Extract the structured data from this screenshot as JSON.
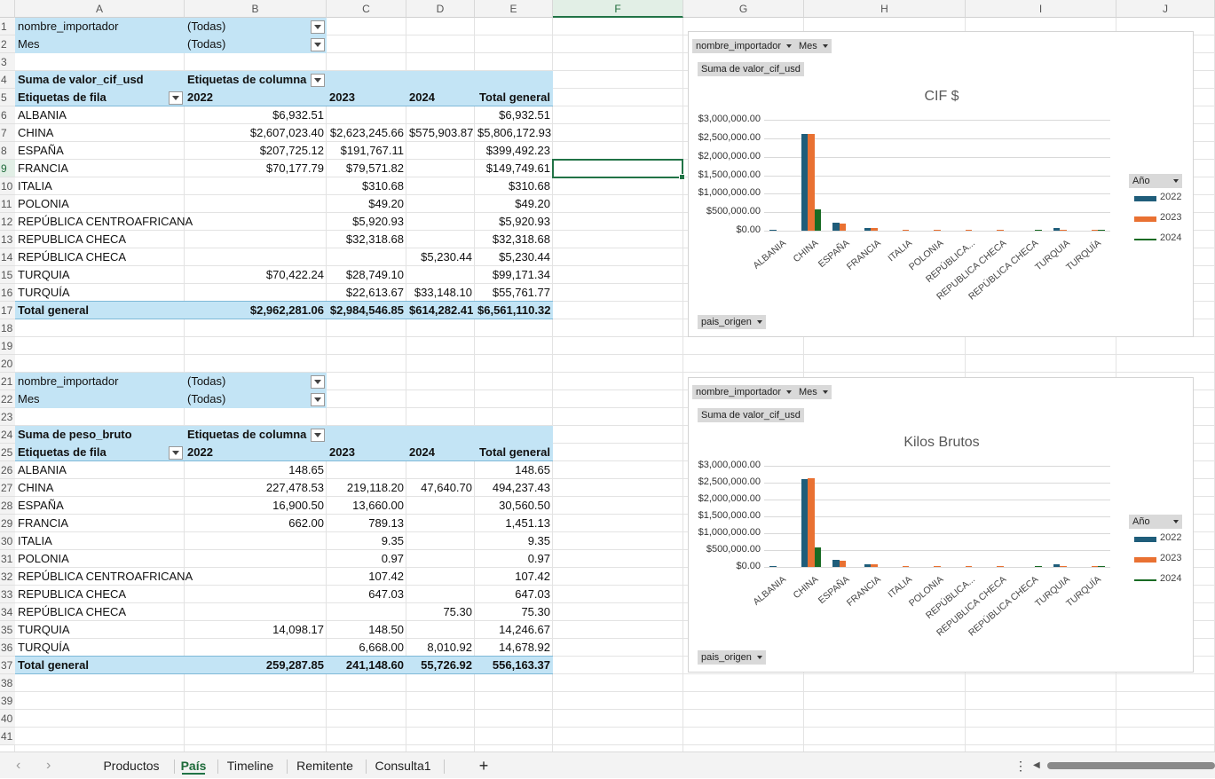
{
  "columns": [
    "A",
    "B",
    "C",
    "D",
    "E",
    "F",
    "G",
    "H",
    "I",
    "J"
  ],
  "selected_column": "F",
  "selected_row": "9",
  "rows": [
    "1",
    "2",
    "3",
    "4",
    "5",
    "6",
    "7",
    "8",
    "9",
    "10",
    "11",
    "12",
    "13",
    "14",
    "15",
    "16",
    "17",
    "18",
    "19",
    "20",
    "21",
    "22",
    "23",
    "24",
    "25",
    "26",
    "27",
    "28",
    "29",
    "30",
    "31",
    "32",
    "33",
    "34",
    "35",
    "36",
    "37",
    "38",
    "39",
    "40",
    "41"
  ],
  "pivot1": {
    "filters": [
      {
        "field": "nombre_importador",
        "value": "(Todas)"
      },
      {
        "field": "Mes",
        "value": "(Todas)"
      }
    ],
    "measure": "Suma de valor_cif_usd",
    "col_labels_title": "Etiquetas de columna",
    "row_labels_title": "Etiquetas de fila",
    "years": [
      "2022",
      "2023",
      "2024"
    ],
    "grand_total_label": "Total general",
    "rows": [
      {
        "label": "ALBANIA",
        "v2022": "$6,932.51",
        "v2023": "",
        "v2024": "",
        "total": "$6,932.51"
      },
      {
        "label": "CHINA",
        "v2022": "$2,607,023.40",
        "v2023": "$2,623,245.66",
        "v2024": "$575,903.87",
        "total": "$5,806,172.93"
      },
      {
        "label": "ESPAÑA",
        "v2022": "$207,725.12",
        "v2023": "$191,767.11",
        "v2024": "",
        "total": "$399,492.23"
      },
      {
        "label": "FRANCIA",
        "v2022": "$70,177.79",
        "v2023": "$79,571.82",
        "v2024": "",
        "total": "$149,749.61"
      },
      {
        "label": "ITALIA",
        "v2022": "",
        "v2023": "$310.68",
        "v2024": "",
        "total": "$310.68"
      },
      {
        "label": "POLONIA",
        "v2022": "",
        "v2023": "$49.20",
        "v2024": "",
        "total": "$49.20"
      },
      {
        "label": "REPÚBLICA CENTROAFRICANA",
        "v2022": "",
        "v2023": "$5,920.93",
        "v2024": "",
        "total": "$5,920.93"
      },
      {
        "label": "REPUBLICA CHECA",
        "v2022": "",
        "v2023": "$32,318.68",
        "v2024": "",
        "total": "$32,318.68"
      },
      {
        "label": "REPÚBLICA CHECA",
        "v2022": "",
        "v2023": "",
        "v2024": "$5,230.44",
        "total": "$5,230.44"
      },
      {
        "label": "TURQUIA",
        "v2022": "$70,422.24",
        "v2023": "$28,749.10",
        "v2024": "",
        "total": "$99,171.34"
      },
      {
        "label": "TURQUÍA",
        "v2022": "",
        "v2023": "$22,613.67",
        "v2024": "$33,148.10",
        "total": "$55,761.77"
      }
    ],
    "grand_total": {
      "v2022": "$2,962,281.06",
      "v2023": "$2,984,546.85",
      "v2024": "$614,282.41",
      "total": "$6,561,110.32"
    }
  },
  "pivot2": {
    "filters": [
      {
        "field": "nombre_importador",
        "value": "(Todas)"
      },
      {
        "field": "Mes",
        "value": "(Todas)"
      }
    ],
    "measure": "Suma de peso_bruto",
    "col_labels_title": "Etiquetas de columna",
    "row_labels_title": "Etiquetas de fila",
    "years": [
      "2022",
      "2023",
      "2024"
    ],
    "grand_total_label": "Total general",
    "rows": [
      {
        "label": "ALBANIA",
        "v2022": "148.65",
        "v2023": "",
        "v2024": "",
        "total": "148.65"
      },
      {
        "label": "CHINA",
        "v2022": "227,478.53",
        "v2023": "219,118.20",
        "v2024": "47,640.70",
        "total": "494,237.43"
      },
      {
        "label": "ESPAÑA",
        "v2022": "16,900.50",
        "v2023": "13,660.00",
        "v2024": "",
        "total": "30,560.50"
      },
      {
        "label": "FRANCIA",
        "v2022": "662.00",
        "v2023": "789.13",
        "v2024": "",
        "total": "1,451.13"
      },
      {
        "label": "ITALIA",
        "v2022": "",
        "v2023": "9.35",
        "v2024": "",
        "total": "9.35"
      },
      {
        "label": "POLONIA",
        "v2022": "",
        "v2023": "0.97",
        "v2024": "",
        "total": "0.97"
      },
      {
        "label": "REPÚBLICA CENTROAFRICANA",
        "v2022": "",
        "v2023": "107.42",
        "v2024": "",
        "total": "107.42"
      },
      {
        "label": "REPUBLICA CHECA",
        "v2022": "",
        "v2023": "647.03",
        "v2024": "",
        "total": "647.03"
      },
      {
        "label": "REPÚBLICA CHECA",
        "v2022": "",
        "v2023": "",
        "v2024": "75.30",
        "total": "75.30"
      },
      {
        "label": "TURQUIA",
        "v2022": "14,098.17",
        "v2023": "148.50",
        "v2024": "",
        "total": "14,246.67"
      },
      {
        "label": "TURQUÍA",
        "v2022": "",
        "v2023": "6,668.00",
        "v2024": "8,010.92",
        "total": "14,678.92"
      }
    ],
    "grand_total": {
      "v2022": "259,287.85",
      "v2023": "241,148.60",
      "v2024": "55,726.92",
      "total": "556,163.37"
    }
  },
  "chart_data": [
    {
      "type": "bar",
      "title": "CIF $",
      "filter_buttons": [
        "nombre_importador",
        "Mes"
      ],
      "value_button": "Suma de valor_cif_usd",
      "axis_button": "pais_origen",
      "legend_title": "Año",
      "legend_position": "right",
      "categories": [
        "ALBANIA",
        "CHINA",
        "ESPAÑA",
        "FRANCIA",
        "ITALIA",
        "POLONIA",
        "REPÚBLICA CENTROAFRICANA",
        "REPUBLICA CHECA",
        "REPÚBLICA CHECA",
        "TURQUIA",
        "TURQUÍA"
      ],
      "category_labels": [
        "ALBANIA",
        "CHINA",
        "ESPAÑA",
        "FRANCIA",
        "ITALIA",
        "POLONIA",
        "REPÚBLICA...",
        "REPUBLICA CHECA",
        "REPÚBLICA CHECA",
        "TURQUIA",
        "TURQUÍA"
      ],
      "series": [
        {
          "name": "2022",
          "color": "#1f5d7a",
          "values": [
            6932.51,
            2607023.4,
            207725.12,
            70177.79,
            0,
            0,
            0,
            0,
            0,
            70422.24,
            0
          ]
        },
        {
          "name": "2023",
          "color": "#e97132",
          "values": [
            0,
            2623245.66,
            191767.11,
            79571.82,
            310.68,
            49.2,
            5920.93,
            32318.68,
            0,
            28749.1,
            22613.67
          ]
        },
        {
          "name": "2024",
          "color": "#196b24",
          "values": [
            0,
            575903.87,
            0,
            0,
            0,
            0,
            0,
            0,
            5230.44,
            0,
            33148.1
          ]
        }
      ],
      "ylim": [
        0,
        3000000
      ],
      "yticks": [
        "$3,000,000.00",
        "$2,500,000.00",
        "$2,000,000.00",
        "$1,500,000.00",
        "$1,000,000.00",
        "$500,000.00",
        "$0.00"
      ],
      "grid": true
    },
    {
      "type": "bar",
      "title": "Kilos Brutos",
      "filter_buttons": [
        "nombre_importador",
        "Mes"
      ],
      "value_button": "Suma de valor_cif_usd",
      "axis_button": "pais_origen",
      "legend_title": "Año",
      "legend_position": "right",
      "categories": [
        "ALBANIA",
        "CHINA",
        "ESPAÑA",
        "FRANCIA",
        "ITALIA",
        "POLONIA",
        "REPÚBLICA CENTROAFRICANA",
        "REPUBLICA CHECA",
        "REPÚBLICA CHECA",
        "TURQUIA",
        "TURQUÍA"
      ],
      "category_labels": [
        "ALBANIA",
        "CHINA",
        "ESPAÑA",
        "FRANCIA",
        "ITALIA",
        "POLONIA",
        "REPÚBLICA...",
        "REPUBLICA CHECA",
        "REPÚBLICA CHECA",
        "TURQUIA",
        "TURQUÍA"
      ],
      "series": [
        {
          "name": "2022",
          "color": "#1f5d7a",
          "values": [
            6932.51,
            2607023.4,
            207725.12,
            70177.79,
            0,
            0,
            0,
            0,
            0,
            70422.24,
            0
          ]
        },
        {
          "name": "2023",
          "color": "#e97132",
          "values": [
            0,
            2623245.66,
            191767.11,
            79571.82,
            310.68,
            49.2,
            5920.93,
            32318.68,
            0,
            28749.1,
            22613.67
          ]
        },
        {
          "name": "2024",
          "color": "#196b24",
          "values": [
            0,
            575903.87,
            0,
            0,
            0,
            0,
            0,
            0,
            5230.44,
            0,
            33148.1
          ]
        }
      ],
      "ylim": [
        0,
        3000000
      ],
      "yticks": [
        "$3,000,000.00",
        "$2,500,000.00",
        "$2,000,000.00",
        "$1,500,000.00",
        "$1,000,000.00",
        "$500,000.00",
        "$0.00"
      ],
      "grid": true
    }
  ],
  "sheet_tabs": [
    "Productos",
    "País",
    "Timeline",
    "Remitente",
    "Consulta1"
  ],
  "active_tab": "País",
  "add_sheet_label": "+",
  "colors": {
    "pivot_header_fill": "#c3e4f5",
    "selection_green": "#217346",
    "series_2022": "#1f5d7a",
    "series_2023": "#e97132",
    "series_2024": "#196b24"
  }
}
